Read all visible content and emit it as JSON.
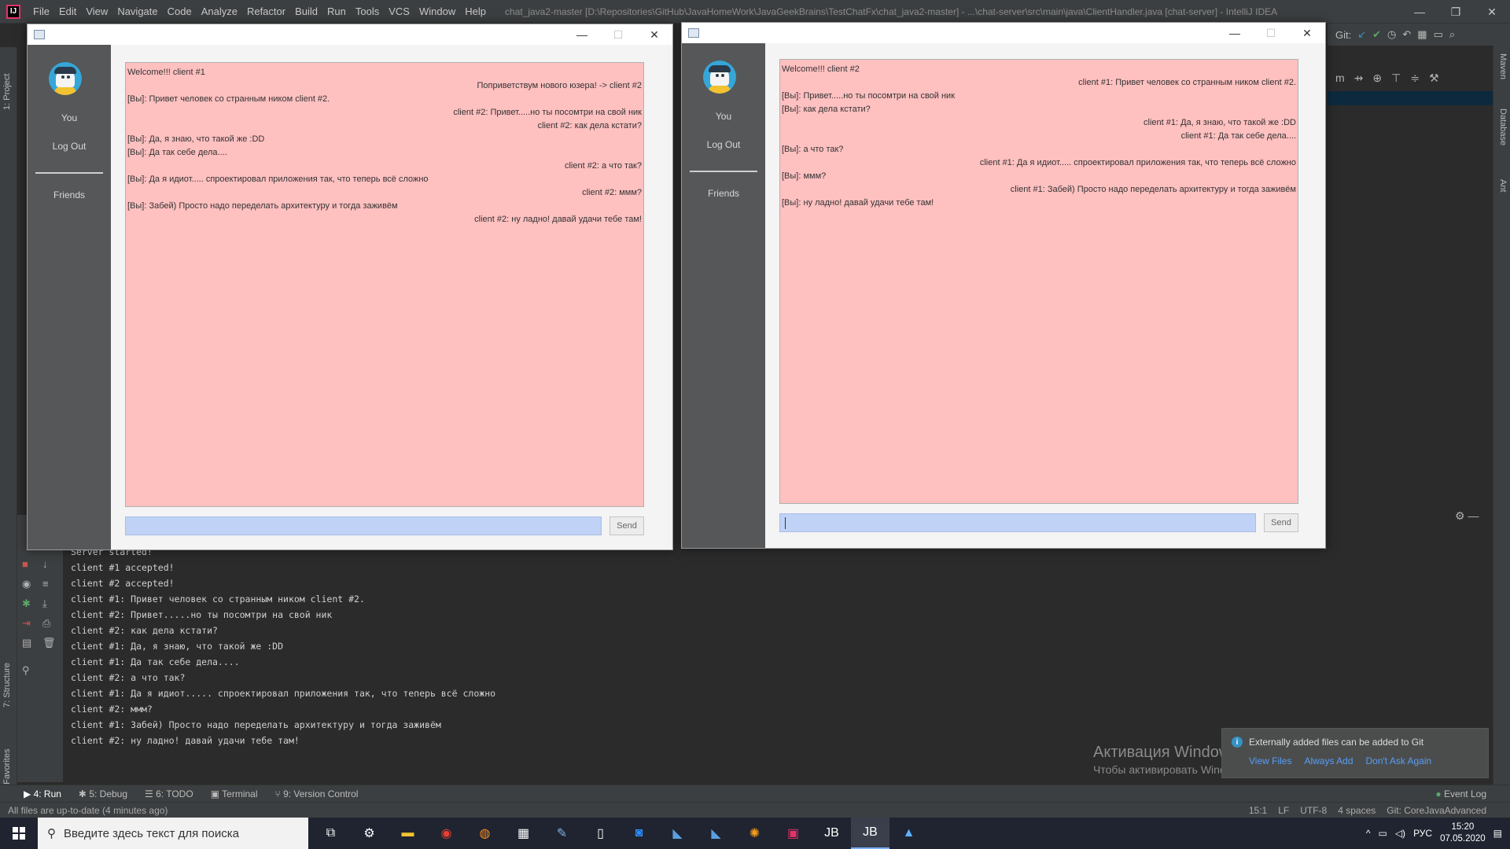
{
  "ide": {
    "menu": [
      "File",
      "Edit",
      "View",
      "Navigate",
      "Code",
      "Analyze",
      "Refactor",
      "Build",
      "Run",
      "Tools",
      "VCS",
      "Window",
      "Help"
    ],
    "title": "chat_java2-master [D:\\Repositories\\GitHub\\JavaHomeWork\\JavaGeekBrains\\TestChatFx\\chat_java2-master] - ...\\chat-server\\src\\main\\java\\ClientHandler.java [chat-server] - IntelliJ IDEA",
    "git_label": "Git:",
    "left_tools": [
      "1: Project",
      "7: Structure",
      "2: Favorites"
    ],
    "right_tools": [
      "Maven",
      "Database",
      "Ant"
    ]
  },
  "console": {
    "lines": [
      "Server started!",
      "client #1 accepted!",
      "client #2 accepted!",
      "client #1: Привет человек со странным ником client #2.",
      "client #2: Привет.....но ты посомтри на свой ник",
      "client #2: как дела кстати?",
      "client #1: Да, я знаю, что такой же :DD",
      "client #1: Да так себе дела....",
      "client #2: а что так?",
      "client #1: Да я идиот..... спроектировал приложения так, что теперь всё сложно",
      "client #2: ммм?",
      "client #1: Забей) Просто надо переделать архитектуру и тогда заживём",
      "client #2: ну ладно! давай удачи тебе там!"
    ]
  },
  "tooltabs": {
    "run": "4: Run",
    "debug": "5: Debug",
    "todo": "6: TODO",
    "terminal": "Terminal",
    "vcs": "9: Version Control",
    "event_log": "Event Log"
  },
  "status": {
    "left": "All files are up-to-date (4 minutes ago)",
    "position": "15:1",
    "line_sep": "LF",
    "encoding": "UTF-8",
    "indent": "4 spaces",
    "branch": "Git: CoreJavaAdvanced"
  },
  "activation": {
    "title": "Активация Windows",
    "subtitle": "Чтобы активировать Windows, перейдите в раздел \"Параметры\"."
  },
  "notification": {
    "text": "Externally added files can be added to Git",
    "view_files": "View Files",
    "always_add": "Always Add",
    "dont_ask": "Don't Ask Again"
  },
  "chat1": {
    "you": "You",
    "logout": "Log Out",
    "friends": "Friends",
    "send": "Send",
    "input_value": "",
    "messages": [
      {
        "text": "Welcome!!! client #1",
        "align": "left"
      },
      {
        "text": "Поприветствум нового юзера! -> client #2",
        "align": "right"
      },
      {
        "text": "[Вы]: Привет человек со странным ником client #2.",
        "align": "left"
      },
      {
        "text": "client #2: Привет.....но ты посомтри на свой ник",
        "align": "right"
      },
      {
        "text": "client #2: как дела кстати?",
        "align": "right"
      },
      {
        "text": "[Вы]: Да, я знаю, что такой же :DD",
        "align": "left"
      },
      {
        "text": "[Вы]: Да так себе дела....",
        "align": "left"
      },
      {
        "text": "client #2: а что так?",
        "align": "right"
      },
      {
        "text": "[Вы]: Да я идиот..... спроектировал приложения так, что теперь всё сложно",
        "align": "left"
      },
      {
        "text": "client #2: ммм?",
        "align": "right"
      },
      {
        "text": "[Вы]: Забей) Просто надо переделать архитектуру и тогда заживём",
        "align": "left"
      },
      {
        "text": "client #2: ну ладно! давай удачи тебе там!",
        "align": "right"
      }
    ]
  },
  "chat2": {
    "you": "You",
    "logout": "Log Out",
    "friends": "Friends",
    "send": "Send",
    "input_value": "",
    "messages": [
      {
        "text": "Welcome!!! client #2",
        "align": "left"
      },
      {
        "text": "client #1: Привет человек со странным ником client #2.",
        "align": "right"
      },
      {
        "text": "[Вы]: Привет.....но ты посомтри на свой ник",
        "align": "left"
      },
      {
        "text": "[Вы]: как дела кстати?",
        "align": "left"
      },
      {
        "text": "client #1: Да, я знаю, что такой же :DD",
        "align": "right"
      },
      {
        "text": "client #1: Да так себе дела....",
        "align": "right"
      },
      {
        "text": "[Вы]: а что так?",
        "align": "left"
      },
      {
        "text": "client #1: Да я идиот..... спроектировал приложения так, что теперь всё сложно",
        "align": "right"
      },
      {
        "text": "[Вы]: ммм?",
        "align": "left"
      },
      {
        "text": "client #1: Забей) Просто надо переделать архитектуру и тогда заживём",
        "align": "right"
      },
      {
        "text": "[Вы]: ну ладно! давай удачи тебе там!",
        "align": "left"
      }
    ]
  },
  "taskbar": {
    "search_placeholder": "Введите здесь текст для поиска",
    "lang": "РУС",
    "time": "15:20",
    "date": "07.05.2020"
  },
  "colors": {
    "chat_bg": "#ffc0c0",
    "input_bg": "#c0d3f7",
    "sidebar_bg": "#555758",
    "ide_bg": "#2b2b2b"
  }
}
